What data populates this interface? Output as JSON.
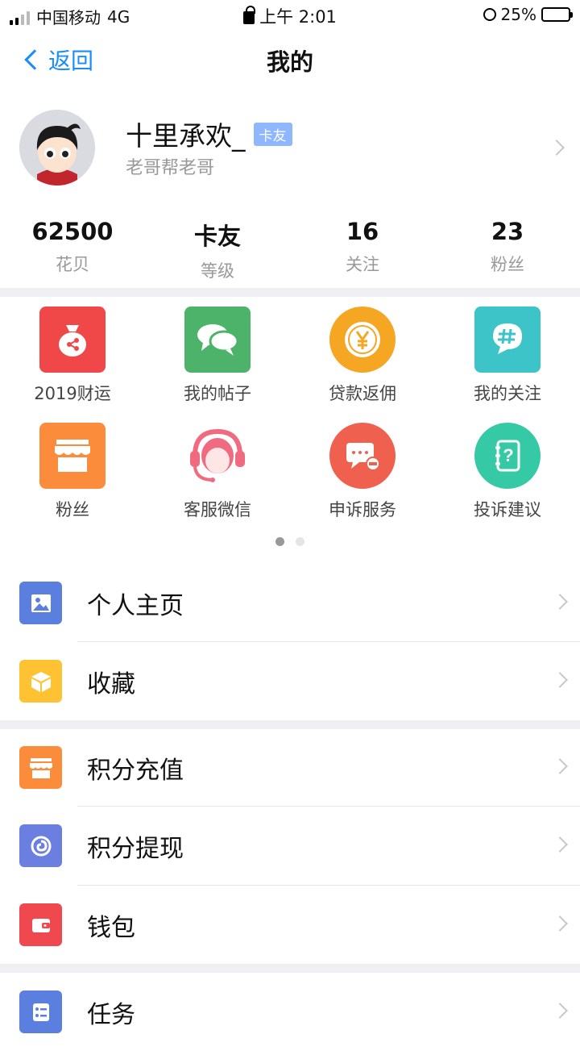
{
  "status_bar": {
    "carrier": "中国移动",
    "network": "4G",
    "time": "上午 2:01",
    "battery": "25%",
    "battery_level": 0.25
  },
  "nav": {
    "back_label": "返回",
    "title": "我的"
  },
  "profile": {
    "name": "十里承欢_",
    "badge": "卡友",
    "subtitle": "老哥帮老哥"
  },
  "stats": [
    {
      "value": "62500",
      "label": "花贝"
    },
    {
      "value": "卡友",
      "label": "等级"
    },
    {
      "value": "16",
      "label": "关注"
    },
    {
      "value": "23",
      "label": "粉丝"
    }
  ],
  "grid": [
    {
      "label": "2019财运",
      "icon": "money-bag-icon",
      "color": "#f04848"
    },
    {
      "label": "我的帖子",
      "icon": "chat-bubbles-icon",
      "color": "#4db36a"
    },
    {
      "label": "贷款返佣",
      "icon": "yen-coin-icon",
      "color": "#f5a623"
    },
    {
      "label": "我的关注",
      "icon": "hashtag-icon",
      "color": "#3cc4c9"
    },
    {
      "label": "粉丝",
      "icon": "store-icon",
      "color": "#fb8c3b"
    },
    {
      "label": "客服微信",
      "icon": "headset-agent-icon",
      "color": "#f06a80"
    },
    {
      "label": "申诉服务",
      "icon": "message-minus-icon",
      "color": "#f0604e"
    },
    {
      "label": "投诉建议",
      "icon": "question-notebook-icon",
      "color": "#36c9a5"
    }
  ],
  "pager": {
    "pages": 2,
    "current": 1
  },
  "menu": [
    {
      "label": "个人主页",
      "icon": "image-icon",
      "color": "#5b7fde"
    },
    {
      "label": "收藏",
      "icon": "box-icon",
      "color": "#ffc233"
    },
    {
      "label": "积分充值",
      "icon": "store-icon",
      "color": "#fb8c3b"
    },
    {
      "label": "积分提现",
      "icon": "spiral-icon",
      "color": "#6a7fe0"
    },
    {
      "label": "钱包",
      "icon": "wallet-icon",
      "color": "#f0484f"
    },
    {
      "label": "任务",
      "icon": "task-list-icon",
      "color": "#5b7fde"
    }
  ]
}
